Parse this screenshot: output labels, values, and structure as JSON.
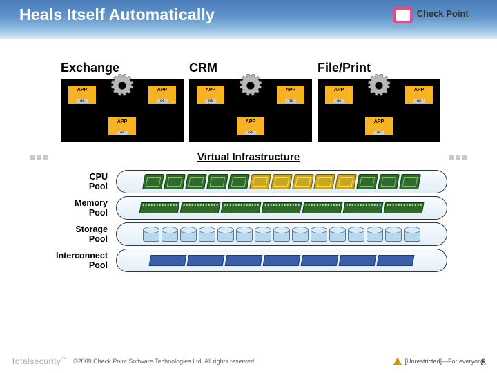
{
  "header": {
    "title": "Heals Itself Automatically",
    "logo_name": "Check Point",
    "logo_sub": "SOFTWARE TECHNOLOGIES LTD."
  },
  "groups": [
    {
      "label": "Exchange",
      "apps": [
        {
          "label": "APP",
          "os": "OS"
        },
        {
          "label": "APP",
          "os": "OS"
        },
        {
          "label": "APP",
          "os": "OS"
        }
      ]
    },
    {
      "label": "CRM",
      "apps": [
        {
          "label": "APP",
          "os": "OS"
        },
        {
          "label": "APP",
          "os": "OS"
        },
        {
          "label": "APP",
          "os": "OS"
        }
      ]
    },
    {
      "label": "File/Print",
      "apps": [
        {
          "label": "APP",
          "os": "OS"
        },
        {
          "label": "APP",
          "os": "OS"
        },
        {
          "label": "APP",
          "os": "OS"
        }
      ]
    }
  ],
  "infra": {
    "title": "Virtual Infrastructure",
    "pools": [
      {
        "name_line1": "CPU",
        "name_line2": "Pool",
        "kind": "cpu"
      },
      {
        "name_line1": "Memory",
        "name_line2": "Pool",
        "kind": "memory"
      },
      {
        "name_line1": "Storage",
        "name_line2": "Pool",
        "kind": "storage"
      },
      {
        "name_line1": "Interconnect",
        "name_line2": "Pool",
        "kind": "net"
      }
    ]
  },
  "footer": {
    "brand": "totalsecurity",
    "copyright": "©2009 Check Point Software Technologies Ltd. All rights reserved.",
    "classification": "[Unrestricted]—For everyone",
    "page": "8"
  }
}
